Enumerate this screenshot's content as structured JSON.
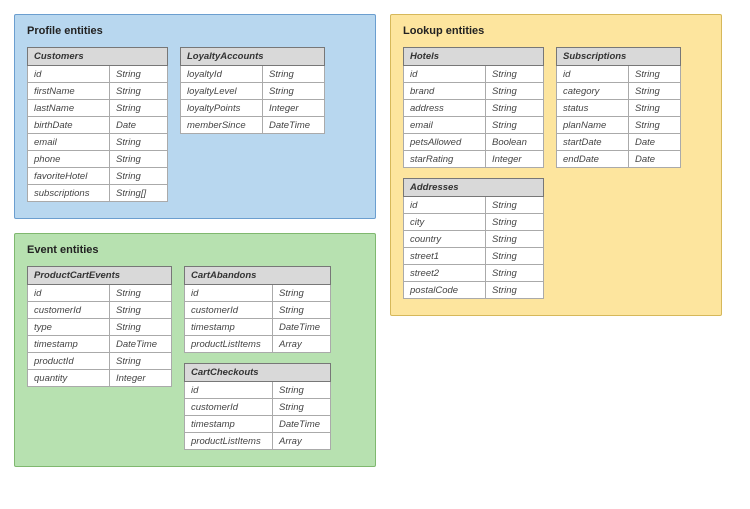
{
  "groups": {
    "profile": {
      "title": "Profile entities",
      "tables": {
        "customers": {
          "name": "Customers",
          "fields": [
            {
              "name": "id",
              "type": "String"
            },
            {
              "name": "firstName",
              "type": "String"
            },
            {
              "name": "lastName",
              "type": "String"
            },
            {
              "name": "birthDate",
              "type": "Date"
            },
            {
              "name": "email",
              "type": "String"
            },
            {
              "name": "phone",
              "type": "String"
            },
            {
              "name": "favoriteHotel",
              "type": "String"
            },
            {
              "name": "subscriptions",
              "type": "String[]"
            }
          ]
        },
        "loyalty": {
          "name": "LoyaltyAccounts",
          "fields": [
            {
              "name": "loyaltyId",
              "type": "String"
            },
            {
              "name": "loyaltyLevel",
              "type": "String"
            },
            {
              "name": "loyaltyPoints",
              "type": "Integer"
            },
            {
              "name": "memberSince",
              "type": "DateTime"
            }
          ]
        }
      }
    },
    "event": {
      "title": "Event entities",
      "tables": {
        "pce": {
          "name": "ProductCartEvents",
          "fields": [
            {
              "name": "id",
              "type": "String"
            },
            {
              "name": "customerId",
              "type": "String"
            },
            {
              "name": "type",
              "type": "String"
            },
            {
              "name": "timestamp",
              "type": "DateTime"
            },
            {
              "name": "productId",
              "type": "String"
            },
            {
              "name": "quantity",
              "type": "Integer"
            }
          ]
        },
        "abandon": {
          "name": "CartAbandons",
          "fields": [
            {
              "name": "id",
              "type": "String"
            },
            {
              "name": "customerId",
              "type": "String"
            },
            {
              "name": "timestamp",
              "type": "DateTime"
            },
            {
              "name": "productListItems",
              "type": "Array"
            }
          ]
        },
        "checkout": {
          "name": "CartCheckouts",
          "fields": [
            {
              "name": "id",
              "type": "String"
            },
            {
              "name": "customerId",
              "type": "String"
            },
            {
              "name": "timestamp",
              "type": "DateTime"
            },
            {
              "name": "productListItems",
              "type": "Array"
            }
          ]
        }
      }
    },
    "lookup": {
      "title": "Lookup entities",
      "tables": {
        "hotels": {
          "name": "Hotels",
          "fields": [
            {
              "name": "id",
              "type": "String"
            },
            {
              "name": "brand",
              "type": "String"
            },
            {
              "name": "address",
              "type": "String"
            },
            {
              "name": "email",
              "type": "String"
            },
            {
              "name": "petsAllowed",
              "type": "Boolean"
            },
            {
              "name": "starRating",
              "type": "Integer"
            }
          ]
        },
        "subs": {
          "name": "Subscriptions",
          "fields": [
            {
              "name": "id",
              "type": "String"
            },
            {
              "name": "category",
              "type": "String"
            },
            {
              "name": "status",
              "type": "String"
            },
            {
              "name": "planName",
              "type": "String"
            },
            {
              "name": "startDate",
              "type": "Date"
            },
            {
              "name": "endDate",
              "type": "Date"
            }
          ]
        },
        "addr": {
          "name": "Addresses",
          "fields": [
            {
              "name": "id",
              "type": "String"
            },
            {
              "name": "city",
              "type": "String"
            },
            {
              "name": "country",
              "type": "String"
            },
            {
              "name": "street1",
              "type": "String"
            },
            {
              "name": "street2",
              "type": "String"
            },
            {
              "name": "postalCode",
              "type": "String"
            }
          ]
        }
      }
    }
  }
}
